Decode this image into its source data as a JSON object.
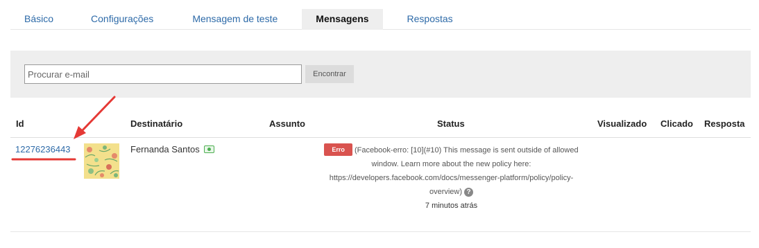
{
  "tabs": [
    {
      "label": "Básico"
    },
    {
      "label": "Configurações"
    },
    {
      "label": "Mensagem de teste"
    },
    {
      "label": "Mensagens",
      "active": true
    },
    {
      "label": "Respostas"
    }
  ],
  "search": {
    "placeholder": "Procurar e-mail",
    "value": "",
    "button_label": "Encontrar"
  },
  "table": {
    "headers": {
      "id": "Id",
      "recipient": "Destinatário",
      "subject": "Assunto",
      "status": "Status",
      "viewed": "Visualizado",
      "clicked": "Clicado",
      "response": "Resposta"
    },
    "rows": [
      {
        "id": "12276236443",
        "recipient": "Fernanda Santos",
        "recipient_icon": "money-icon",
        "subject": "",
        "status_badge": "Erro",
        "status_message": "(Facebook-erro: [10](#10) This message is sent outside of allowed window. Learn more about the new policy here: https://developers.facebook.com/docs/messenger-platform/policy/policy-overview)",
        "time": "7 minutos atrás",
        "viewed": "",
        "clicked": "",
        "response": ""
      }
    ]
  },
  "colors": {
    "link": "#2d6aa8",
    "error_badge": "#d9534f",
    "annotation": "#e53935",
    "panel_bg": "#eeeeee"
  }
}
